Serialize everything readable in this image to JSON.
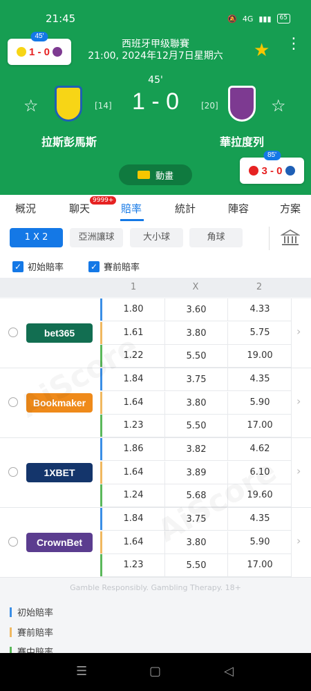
{
  "status": {
    "time": "21:45",
    "battery": "65",
    "signal": "4G"
  },
  "header": {
    "league": "西班牙甲级聯賽",
    "datetime": "21:00, 2024年12月7日星期六",
    "minute": "45'",
    "score": "1 - 0",
    "home": {
      "name": "拉斯彭馬斯",
      "rank": "[14]",
      "color": "#f7d516"
    },
    "away": {
      "name": "華拉度列",
      "rank": "[20]",
      "color": "#7d3a91"
    },
    "animation_label": "動畫",
    "mini_left": {
      "minute": "45'",
      "score": "1 - 0"
    },
    "mini_right": {
      "minute": "85'",
      "score": "3 - 0"
    }
  },
  "tabs": [
    "概況",
    "聊天",
    "賠率",
    "統計",
    "陣容",
    "方案"
  ],
  "chat_badge": "9999+",
  "filters": {
    "markets": [
      "1 X 2",
      "亞洲讓球",
      "大小球",
      "角球"
    ],
    "checks": [
      "初始賠率",
      "賽前賠率"
    ]
  },
  "table": {
    "headers": [
      "1",
      "X",
      "2"
    ],
    "bookmakers": [
      {
        "name": "bet365",
        "color": "#126e51",
        "rows": [
          [
            "1.80",
            "3.60",
            "4.33"
          ],
          [
            "1.61",
            "3.80",
            "5.75"
          ],
          [
            "1.22",
            "5.50",
            "19.00"
          ]
        ]
      },
      {
        "name": "Bookmaker",
        "color": "#ef8a1a",
        "rows": [
          [
            "1.84",
            "3.75",
            "4.35"
          ],
          [
            "1.64",
            "3.80",
            "5.90"
          ],
          [
            "1.23",
            "5.50",
            "17.00"
          ]
        ]
      },
      {
        "name": "1XBET",
        "color": "#14356b",
        "rows": [
          [
            "1.86",
            "3.82",
            "4.62"
          ],
          [
            "1.64",
            "3.89",
            "6.10"
          ],
          [
            "1.24",
            "5.68",
            "19.60"
          ]
        ]
      },
      {
        "name": "CrownBet",
        "color": "#5b3d8f",
        "rows": [
          [
            "1.84",
            "3.75",
            "4.35"
          ],
          [
            "1.64",
            "3.80",
            "5.90"
          ],
          [
            "1.23",
            "5.50",
            "17.00"
          ]
        ]
      }
    ]
  },
  "gamble_note": "Gamble Responsibly. Gambling Therapy. 18+",
  "legend": [
    {
      "label": "初始賠率",
      "color": "#3a8ee6"
    },
    {
      "label": "賽前賠率",
      "color": "#f0b860"
    },
    {
      "label": "賽中賠率",
      "color": "#5bb85b"
    }
  ],
  "row_colors": [
    "#3a8ee6",
    "#f0b860",
    "#5bb85b"
  ],
  "watermark": "AiScore"
}
